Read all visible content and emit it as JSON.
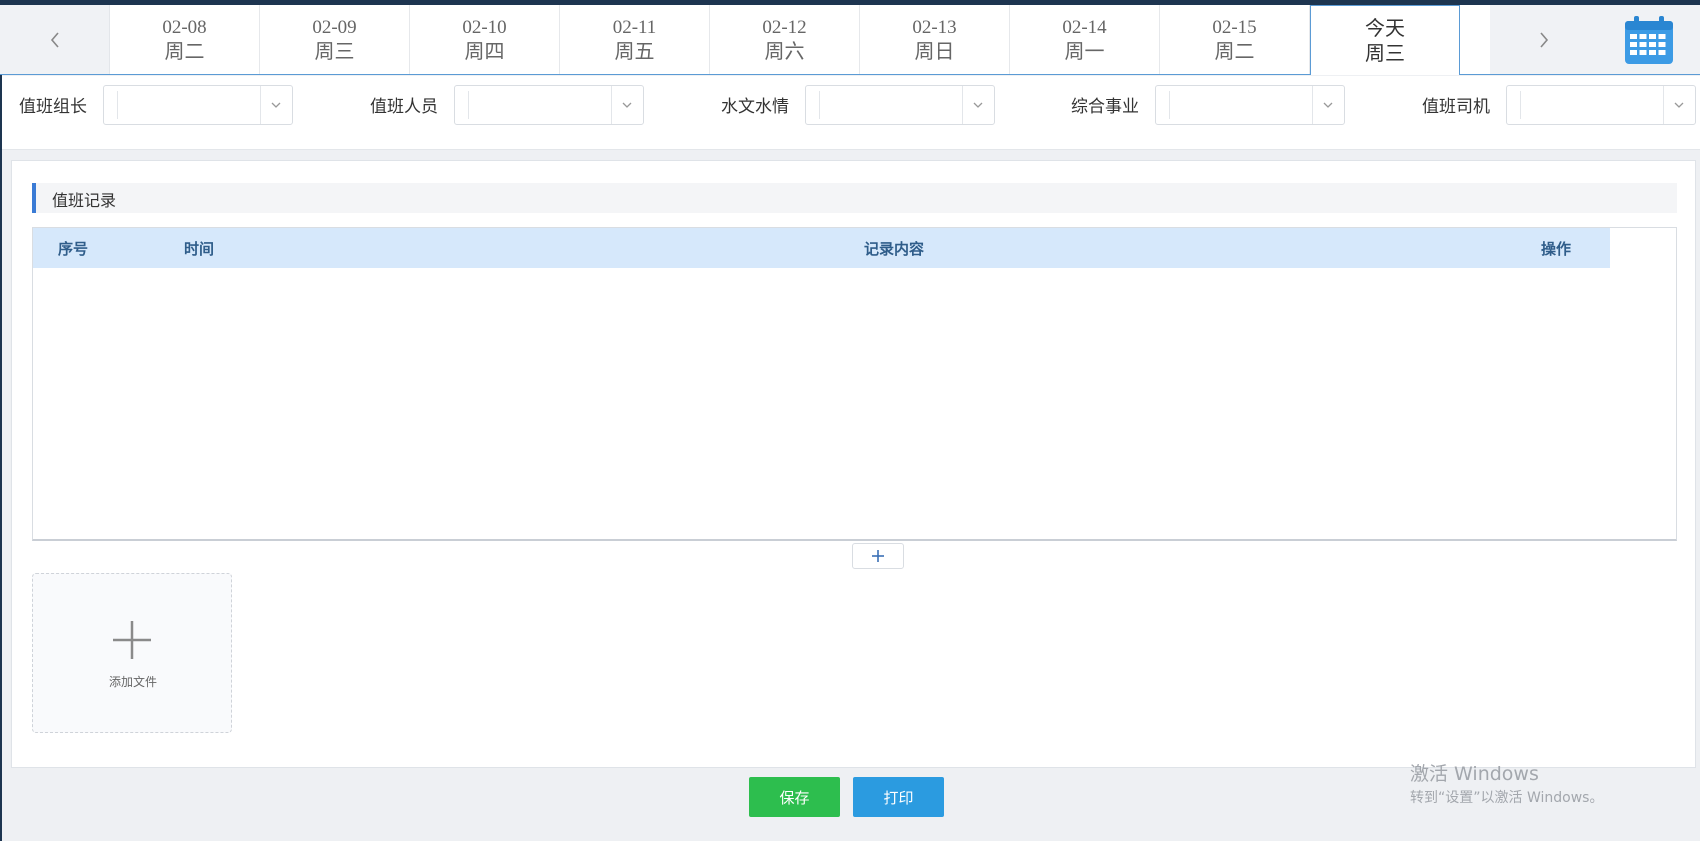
{
  "date_nav": {
    "days": [
      {
        "date": "02-08",
        "weekday": "周二"
      },
      {
        "date": "02-09",
        "weekday": "周三"
      },
      {
        "date": "02-10",
        "weekday": "周四"
      },
      {
        "date": "02-11",
        "weekday": "周五"
      },
      {
        "date": "02-12",
        "weekday": "周六"
      },
      {
        "date": "02-13",
        "weekday": "周日"
      },
      {
        "date": "02-14",
        "weekday": "周一"
      },
      {
        "date": "02-15",
        "weekday": "周二"
      }
    ],
    "today": {
      "date": "今天",
      "weekday": "周三"
    },
    "prev_icon": "chevron-left-icon",
    "next_icon": "chevron-right-icon",
    "calendar_icon": "calendar-icon"
  },
  "duty_fields": [
    {
      "label": "值班组长",
      "value": ""
    },
    {
      "label": "值班人员",
      "value": ""
    },
    {
      "label": "水文水情",
      "value": ""
    },
    {
      "label": "综合事业",
      "value": ""
    },
    {
      "label": "值班司机",
      "value": ""
    }
  ],
  "records": {
    "section_title": "值班记录",
    "columns": [
      "序号",
      "时间",
      "记录内容",
      "操作"
    ],
    "rows": [],
    "add_row_icon": "plus-icon"
  },
  "upload": {
    "label": "添加文件"
  },
  "actions": {
    "save": "保存",
    "print": "打印"
  },
  "watermark": {
    "line1": "激活 Windows",
    "line2": "转到“设置”以激活 Windows。"
  },
  "colors": {
    "accent_blue": "#3a7bd5",
    "header_bg": "#d6e8fb",
    "save_green": "#2dbe4e",
    "print_blue": "#2b9be0",
    "top_bar": "#1d3550"
  }
}
